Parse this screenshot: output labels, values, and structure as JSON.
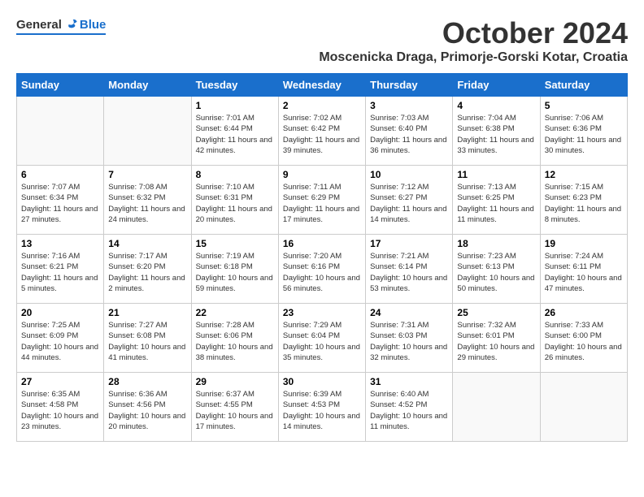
{
  "header": {
    "logo_general": "General",
    "logo_blue": "Blue",
    "month_title": "October 2024",
    "location": "Moscenicka Draga, Primorje-Gorski Kotar, Croatia"
  },
  "weekdays": [
    "Sunday",
    "Monday",
    "Tuesday",
    "Wednesday",
    "Thursday",
    "Friday",
    "Saturday"
  ],
  "weeks": [
    [
      {
        "day": "",
        "sunrise": "",
        "sunset": "",
        "daylight": ""
      },
      {
        "day": "",
        "sunrise": "",
        "sunset": "",
        "daylight": ""
      },
      {
        "day": "1",
        "sunrise": "Sunrise: 7:01 AM",
        "sunset": "Sunset: 6:44 PM",
        "daylight": "Daylight: 11 hours and 42 minutes."
      },
      {
        "day": "2",
        "sunrise": "Sunrise: 7:02 AM",
        "sunset": "Sunset: 6:42 PM",
        "daylight": "Daylight: 11 hours and 39 minutes."
      },
      {
        "day": "3",
        "sunrise": "Sunrise: 7:03 AM",
        "sunset": "Sunset: 6:40 PM",
        "daylight": "Daylight: 11 hours and 36 minutes."
      },
      {
        "day": "4",
        "sunrise": "Sunrise: 7:04 AM",
        "sunset": "Sunset: 6:38 PM",
        "daylight": "Daylight: 11 hours and 33 minutes."
      },
      {
        "day": "5",
        "sunrise": "Sunrise: 7:06 AM",
        "sunset": "Sunset: 6:36 PM",
        "daylight": "Daylight: 11 hours and 30 minutes."
      }
    ],
    [
      {
        "day": "6",
        "sunrise": "Sunrise: 7:07 AM",
        "sunset": "Sunset: 6:34 PM",
        "daylight": "Daylight: 11 hours and 27 minutes."
      },
      {
        "day": "7",
        "sunrise": "Sunrise: 7:08 AM",
        "sunset": "Sunset: 6:32 PM",
        "daylight": "Daylight: 11 hours and 24 minutes."
      },
      {
        "day": "8",
        "sunrise": "Sunrise: 7:10 AM",
        "sunset": "Sunset: 6:31 PM",
        "daylight": "Daylight: 11 hours and 20 minutes."
      },
      {
        "day": "9",
        "sunrise": "Sunrise: 7:11 AM",
        "sunset": "Sunset: 6:29 PM",
        "daylight": "Daylight: 11 hours and 17 minutes."
      },
      {
        "day": "10",
        "sunrise": "Sunrise: 7:12 AM",
        "sunset": "Sunset: 6:27 PM",
        "daylight": "Daylight: 11 hours and 14 minutes."
      },
      {
        "day": "11",
        "sunrise": "Sunrise: 7:13 AM",
        "sunset": "Sunset: 6:25 PM",
        "daylight": "Daylight: 11 hours and 11 minutes."
      },
      {
        "day": "12",
        "sunrise": "Sunrise: 7:15 AM",
        "sunset": "Sunset: 6:23 PM",
        "daylight": "Daylight: 11 hours and 8 minutes."
      }
    ],
    [
      {
        "day": "13",
        "sunrise": "Sunrise: 7:16 AM",
        "sunset": "Sunset: 6:21 PM",
        "daylight": "Daylight: 11 hours and 5 minutes."
      },
      {
        "day": "14",
        "sunrise": "Sunrise: 7:17 AM",
        "sunset": "Sunset: 6:20 PM",
        "daylight": "Daylight: 11 hours and 2 minutes."
      },
      {
        "day": "15",
        "sunrise": "Sunrise: 7:19 AM",
        "sunset": "Sunset: 6:18 PM",
        "daylight": "Daylight: 10 hours and 59 minutes."
      },
      {
        "day": "16",
        "sunrise": "Sunrise: 7:20 AM",
        "sunset": "Sunset: 6:16 PM",
        "daylight": "Daylight: 10 hours and 56 minutes."
      },
      {
        "day": "17",
        "sunrise": "Sunrise: 7:21 AM",
        "sunset": "Sunset: 6:14 PM",
        "daylight": "Daylight: 10 hours and 53 minutes."
      },
      {
        "day": "18",
        "sunrise": "Sunrise: 7:23 AM",
        "sunset": "Sunset: 6:13 PM",
        "daylight": "Daylight: 10 hours and 50 minutes."
      },
      {
        "day": "19",
        "sunrise": "Sunrise: 7:24 AM",
        "sunset": "Sunset: 6:11 PM",
        "daylight": "Daylight: 10 hours and 47 minutes."
      }
    ],
    [
      {
        "day": "20",
        "sunrise": "Sunrise: 7:25 AM",
        "sunset": "Sunset: 6:09 PM",
        "daylight": "Daylight: 10 hours and 44 minutes."
      },
      {
        "day": "21",
        "sunrise": "Sunrise: 7:27 AM",
        "sunset": "Sunset: 6:08 PM",
        "daylight": "Daylight: 10 hours and 41 minutes."
      },
      {
        "day": "22",
        "sunrise": "Sunrise: 7:28 AM",
        "sunset": "Sunset: 6:06 PM",
        "daylight": "Daylight: 10 hours and 38 minutes."
      },
      {
        "day": "23",
        "sunrise": "Sunrise: 7:29 AM",
        "sunset": "Sunset: 6:04 PM",
        "daylight": "Daylight: 10 hours and 35 minutes."
      },
      {
        "day": "24",
        "sunrise": "Sunrise: 7:31 AM",
        "sunset": "Sunset: 6:03 PM",
        "daylight": "Daylight: 10 hours and 32 minutes."
      },
      {
        "day": "25",
        "sunrise": "Sunrise: 7:32 AM",
        "sunset": "Sunset: 6:01 PM",
        "daylight": "Daylight: 10 hours and 29 minutes."
      },
      {
        "day": "26",
        "sunrise": "Sunrise: 7:33 AM",
        "sunset": "Sunset: 6:00 PM",
        "daylight": "Daylight: 10 hours and 26 minutes."
      }
    ],
    [
      {
        "day": "27",
        "sunrise": "Sunrise: 6:35 AM",
        "sunset": "Sunset: 4:58 PM",
        "daylight": "Daylight: 10 hours and 23 minutes."
      },
      {
        "day": "28",
        "sunrise": "Sunrise: 6:36 AM",
        "sunset": "Sunset: 4:56 PM",
        "daylight": "Daylight: 10 hours and 20 minutes."
      },
      {
        "day": "29",
        "sunrise": "Sunrise: 6:37 AM",
        "sunset": "Sunset: 4:55 PM",
        "daylight": "Daylight: 10 hours and 17 minutes."
      },
      {
        "day": "30",
        "sunrise": "Sunrise: 6:39 AM",
        "sunset": "Sunset: 4:53 PM",
        "daylight": "Daylight: 10 hours and 14 minutes."
      },
      {
        "day": "31",
        "sunrise": "Sunrise: 6:40 AM",
        "sunset": "Sunset: 4:52 PM",
        "daylight": "Daylight: 10 hours and 11 minutes."
      },
      {
        "day": "",
        "sunrise": "",
        "sunset": "",
        "daylight": ""
      },
      {
        "day": "",
        "sunrise": "",
        "sunset": "",
        "daylight": ""
      }
    ]
  ]
}
